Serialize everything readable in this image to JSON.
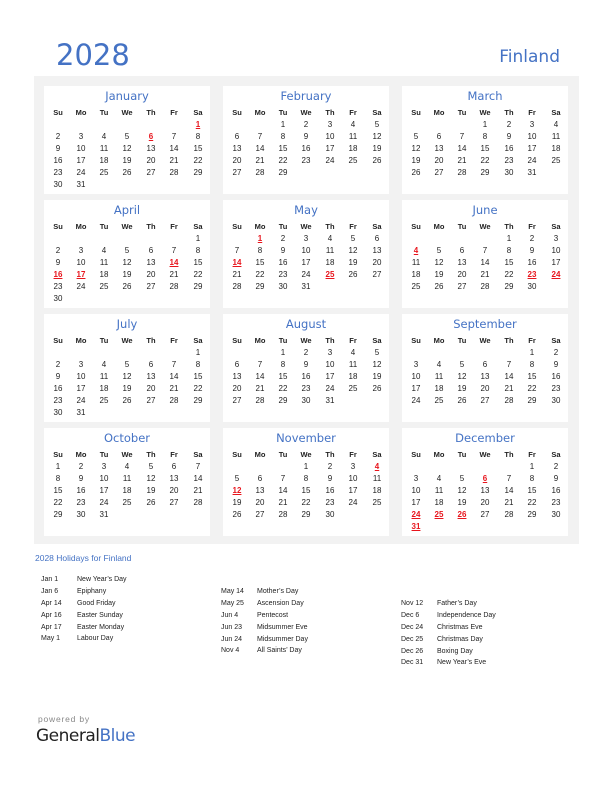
{
  "header": {
    "year": "2028",
    "country": "Finland"
  },
  "weekdays": [
    "Su",
    "Mo",
    "Tu",
    "We",
    "Th",
    "Fr",
    "Sa"
  ],
  "months": [
    {
      "name": "January",
      "start": 6,
      "days": 31,
      "holidays": [
        1,
        6
      ]
    },
    {
      "name": "February",
      "start": 2,
      "days": 29,
      "holidays": []
    },
    {
      "name": "March",
      "start": 3,
      "days": 31,
      "holidays": []
    },
    {
      "name": "April",
      "start": 6,
      "days": 30,
      "holidays": [
        14,
        16,
        17
      ]
    },
    {
      "name": "May",
      "start": 1,
      "days": 31,
      "holidays": [
        1,
        14,
        25
      ]
    },
    {
      "name": "June",
      "start": 4,
      "days": 30,
      "holidays": [
        4,
        23,
        24
      ]
    },
    {
      "name": "July",
      "start": 6,
      "days": 31,
      "holidays": []
    },
    {
      "name": "August",
      "start": 2,
      "days": 31,
      "holidays": []
    },
    {
      "name": "September",
      "start": 5,
      "days": 30,
      "holidays": []
    },
    {
      "name": "October",
      "start": 0,
      "days": 31,
      "holidays": []
    },
    {
      "name": "November",
      "start": 3,
      "days": 30,
      "holidays": [
        4,
        12
      ]
    },
    {
      "name": "December",
      "start": 5,
      "days": 31,
      "holidays": [
        6,
        24,
        25,
        26,
        31
      ]
    }
  ],
  "holidays_title": "2028 Holidays for Finland",
  "holiday_columns": [
    [
      {
        "date": "Jan 1",
        "name": "New Year’s Day"
      },
      {
        "date": "Jan 6",
        "name": "Epiphany"
      },
      {
        "date": "Apr 14",
        "name": "Good Friday"
      },
      {
        "date": "Apr 16",
        "name": "Easter Sunday"
      },
      {
        "date": "Apr 17",
        "name": "Easter Monday"
      },
      {
        "date": "May 1",
        "name": "Labour Day"
      }
    ],
    [
      {
        "date": "May 14",
        "name": "Mother’s Day"
      },
      {
        "date": "May 25",
        "name": "Ascension Day"
      },
      {
        "date": "Jun 4",
        "name": "Pentecost"
      },
      {
        "date": "Jun 23",
        "name": "Midsummer Eve"
      },
      {
        "date": "Jun 24",
        "name": "Midsummer Day"
      },
      {
        "date": "Nov 4",
        "name": "All Saints’ Day"
      }
    ],
    [
      {
        "date": "Nov 12",
        "name": "Father’s Day"
      },
      {
        "date": "Dec 6",
        "name": "Independence Day"
      },
      {
        "date": "Dec 24",
        "name": "Christmas Eve"
      },
      {
        "date": "Dec 25",
        "name": "Christmas Day"
      },
      {
        "date": "Dec 26",
        "name": "Boxing Day"
      },
      {
        "date": "Dec 31",
        "name": "New Year’s Eve"
      }
    ]
  ],
  "footer": {
    "powered_by": "powered by",
    "brand_part1": "General",
    "brand_part2": "Blue"
  },
  "colors": {
    "accent": "#4472c4",
    "holiday": "#e8141c",
    "panel_bg": "#f2f2f2"
  }
}
